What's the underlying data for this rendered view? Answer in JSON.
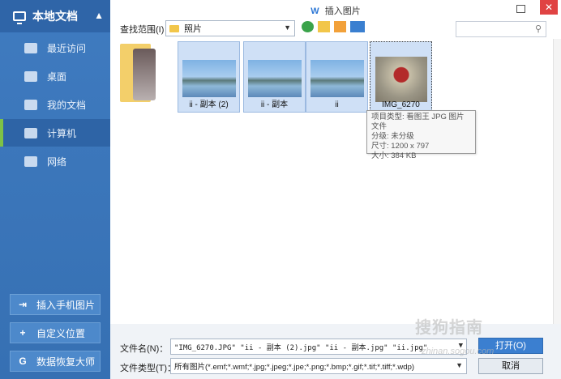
{
  "sidebar": {
    "header": "本地文档",
    "items": [
      {
        "label": "最近访问"
      },
      {
        "label": "桌面"
      },
      {
        "label": "我的文档"
      },
      {
        "label": "计算机"
      },
      {
        "label": "网络"
      }
    ],
    "buttons": {
      "phone": "插入手机图片",
      "custom": "自定义位置",
      "recovery": "数据恢复大师"
    }
  },
  "dialog": {
    "title": "插入图片",
    "close": "✕"
  },
  "toolbar": {
    "lookin_label": "查找范围(I)：",
    "lookin_value": "照片"
  },
  "files": [
    {
      "name": "ii - 副本 (2)"
    },
    {
      "name": "ii - 副本"
    },
    {
      "name": "ii"
    },
    {
      "name": "IMG_6270"
    }
  ],
  "tooltip": {
    "line1": "项目类型: 看图王 JPG 图片文件",
    "line2": "分级: 未分级",
    "line3": "尺寸: 1200 x 797",
    "line4": "大小: 384 KB"
  },
  "bottom": {
    "filename_label": "文件名(N)：",
    "filename_value": "\"IMG_6270.JPG\" \"ii - 副本 (2).jpg\" \"ii - 副本.jpg\" \"ii.jpg\"",
    "filetype_label": "文件类型(T)：",
    "filetype_value": "所有图片(*.emf;*.wmf;*.jpg;*.jpeg;*.jpe;*.png;*.bmp;*.gif;*.tif;*.tiff;*.wdp)",
    "open": "打开(O)",
    "cancel": "取消"
  },
  "watermark": {
    "text": "搜狗指南",
    "url": "zhinan.sogou.com"
  },
  "colors": {
    "sidebar": "#3f7bc0",
    "accent": "#7ec246",
    "primary": "#3b7fd0",
    "close": "#e04343"
  }
}
